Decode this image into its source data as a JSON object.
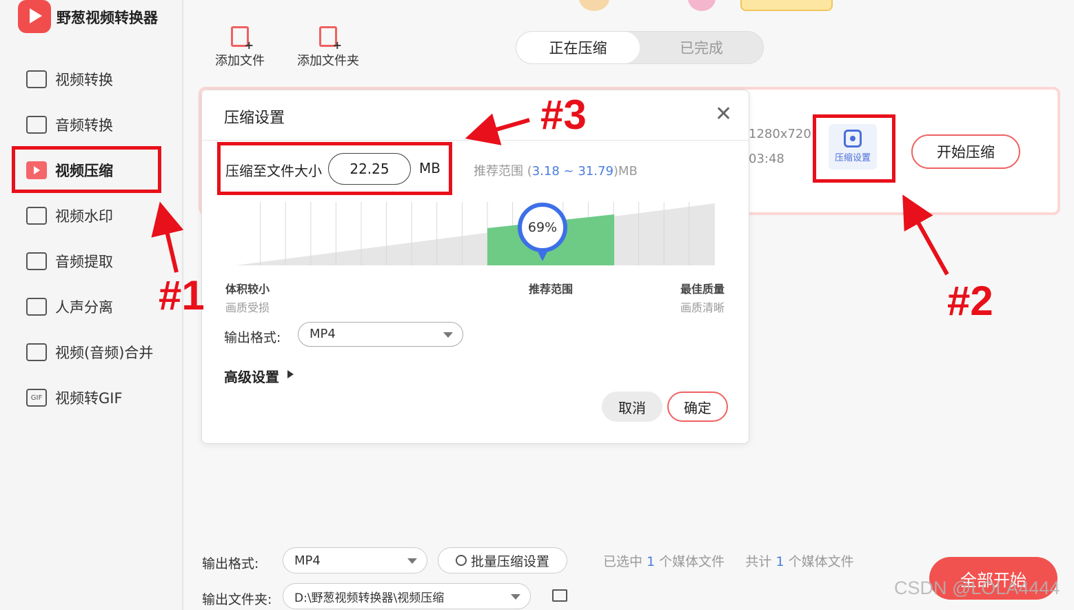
{
  "app": {
    "title": "野葱视频转换器"
  },
  "sidebar": {
    "items": [
      {
        "label": "视频转换",
        "icon": "video-convert-icon"
      },
      {
        "label": "音频转换",
        "icon": "audio-convert-icon"
      },
      {
        "label": "视频压缩",
        "icon": "video-compress-icon",
        "active": true
      },
      {
        "label": "视频水印",
        "icon": "watermark-icon"
      },
      {
        "label": "音频提取",
        "icon": "audio-extract-icon"
      },
      {
        "label": "人声分离",
        "icon": "voice-separate-icon"
      },
      {
        "label": "视频(音频)合并",
        "icon": "merge-icon"
      },
      {
        "label": "视频转GIF",
        "icon": "gif-icon"
      }
    ]
  },
  "toolbar": {
    "add_file": "添加文件",
    "add_folder": "添加文件夹"
  },
  "tabs": {
    "compressing": "正在压缩",
    "completed": "已完成"
  },
  "file_card": {
    "resolution": "1280x720",
    "duration": "03:48",
    "settings_label": "压缩设置",
    "start_label": "开始压缩"
  },
  "modal": {
    "title": "压缩设置",
    "close": "✕",
    "size_label": "压缩至文件大小",
    "size_value": "22.25",
    "size_unit": "MB",
    "range_prefix": "推荐范围 (",
    "range_min": "3.18",
    "range_sep": " ~ ",
    "range_max": "31.79",
    "range_suffix": ")MB",
    "percent": "69%",
    "percent_value": 0.69,
    "scale": {
      "left_title": "体积较小",
      "left_sub": "画质受损",
      "mid_title": "推荐范围",
      "right_title": "最佳质量",
      "right_sub": "画质清晰"
    },
    "format_label": "输出格式:",
    "format_value": "MP4",
    "advanced": "高级设置",
    "cancel": "取消",
    "ok": "确定"
  },
  "bottom": {
    "format_label": "输出格式:",
    "format_value": "MP4",
    "batch": "批量压缩设置",
    "selected_prefix": "已选中 ",
    "selected_count": "1",
    "selected_suffix": " 个媒体文件",
    "total_prefix": "共计 ",
    "total_count": "1",
    "total_suffix": " 个媒体文件",
    "folder_label": "输出文件夹:",
    "folder_value": "D:\\野葱视频转换器\\视频压缩",
    "start_all": "全部开始"
  },
  "annotations": {
    "a1": "#1",
    "a2": "#2",
    "a3": "#3"
  },
  "watermark": "CSDN @LOLA4444",
  "colors": {
    "accent": "#f06060",
    "annotation": "#e8101a",
    "blue": "#4a7de0",
    "green": "#6dcb86"
  }
}
